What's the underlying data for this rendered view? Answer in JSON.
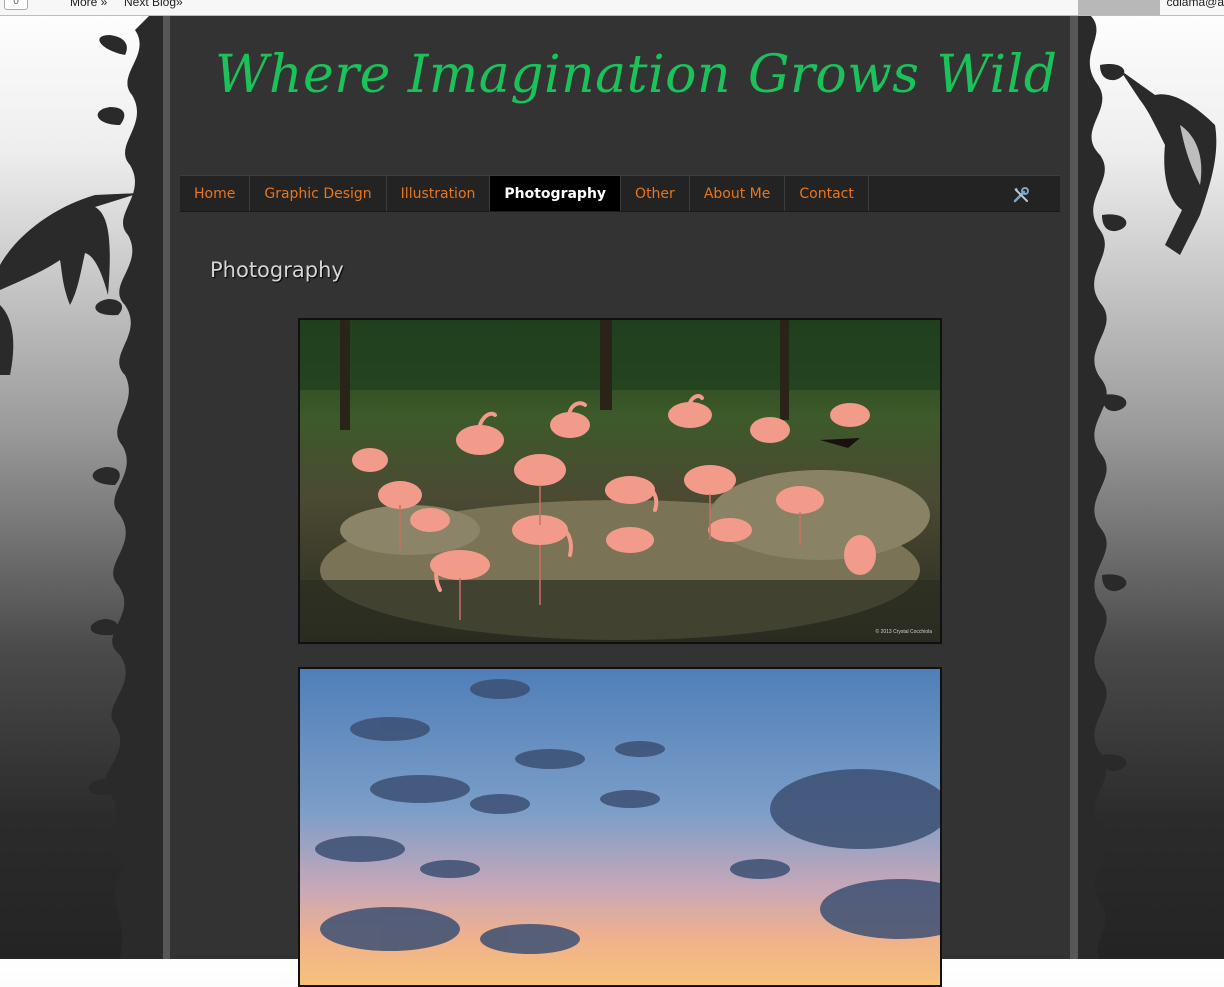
{
  "navbar": {
    "counter": "0",
    "more_label": "More »",
    "next_blog_label": "Next Blog»",
    "user_email": "cdlama@a"
  },
  "blog": {
    "title": "Where Imagination Grows Wild"
  },
  "menu": {
    "tabs": [
      {
        "label": "Home",
        "active": false
      },
      {
        "label": "Graphic Design",
        "active": false
      },
      {
        "label": "Illustration",
        "active": false
      },
      {
        "label": "Photography",
        "active": true
      },
      {
        "label": "Other",
        "active": false
      },
      {
        "label": "About Me",
        "active": false
      },
      {
        "label": "Contact",
        "active": false
      }
    ],
    "tools_icon": "wrench-screwdriver-icon"
  },
  "page": {
    "heading": "Photography",
    "photos": [
      {
        "subject": "flamingos",
        "credit": "© 2013 Crystal Cocchiola"
      },
      {
        "subject": "sunset sky"
      }
    ]
  },
  "colors": {
    "title_green": "#1bc25a",
    "menu_orange": "#e8761c",
    "content_bg": "#333333"
  }
}
